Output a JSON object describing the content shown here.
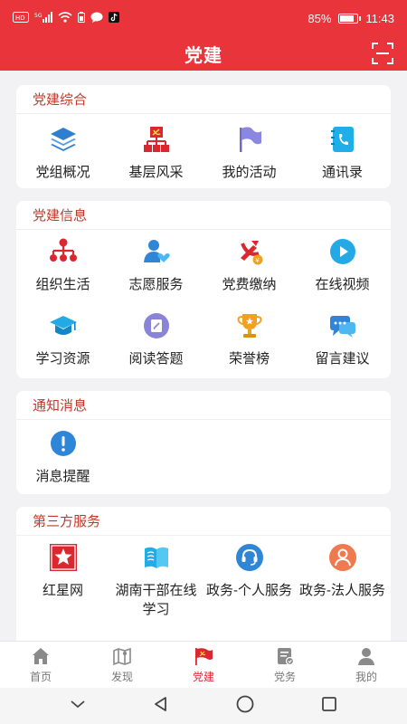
{
  "status": {
    "left_icons": [
      "hd-icon",
      "5g-signal-icon",
      "wifi-icon",
      "battery-saver-icon",
      "message-icon",
      "tiktok-icon"
    ],
    "battery_percent": "85%",
    "battery_level": 0.85,
    "time": "11:43"
  },
  "header": {
    "title": "党建",
    "scan_icon": "scan-icon"
  },
  "sections": [
    {
      "title": "党建综合",
      "items": [
        {
          "label": "党组概况",
          "icon": "layers-icon"
        },
        {
          "label": "基层风采",
          "icon": "org-party-icon"
        },
        {
          "label": "我的活动",
          "icon": "flag-icon"
        },
        {
          "label": "通讯录",
          "icon": "phonebook-icon"
        }
      ]
    },
    {
      "title": "党建信息",
      "items": [
        {
          "label": "组织生活",
          "icon": "org-tree-icon"
        },
        {
          "label": "志愿服务",
          "icon": "volunteer-icon"
        },
        {
          "label": "党费缴纳",
          "icon": "party-fee-icon"
        },
        {
          "label": "在线视频",
          "icon": "video-play-icon"
        },
        {
          "label": "学习资源",
          "icon": "graduation-cap-icon"
        },
        {
          "label": "阅读答题",
          "icon": "reading-icon"
        },
        {
          "label": "荣誉榜",
          "icon": "trophy-icon"
        },
        {
          "label": "留言建议",
          "icon": "chat-icon"
        }
      ]
    },
    {
      "title": "通知消息",
      "items": [
        {
          "label": "消息提醒",
          "icon": "alert-icon"
        }
      ]
    },
    {
      "title": "第三方服务",
      "items": [
        {
          "label": "红星网",
          "icon": "red-star-icon"
        },
        {
          "label": "湖南干部在线学习",
          "icon": "book-icon"
        },
        {
          "label": "政务-个人服务",
          "icon": "headset-icon"
        },
        {
          "label": "政务-法人服务",
          "icon": "person-service-icon"
        }
      ]
    }
  ],
  "tabs": [
    {
      "label": "首页",
      "icon": "home-icon"
    },
    {
      "label": "发现",
      "icon": "map-icon"
    },
    {
      "label": "党建",
      "icon": "party-flag-icon",
      "active": true
    },
    {
      "label": "党务",
      "icon": "document-icon"
    },
    {
      "label": "我的",
      "icon": "user-icon"
    }
  ],
  "colors": {
    "brand_red": "#e8343a",
    "section_title": "#c0392b",
    "active_tab": "#d9282f"
  }
}
